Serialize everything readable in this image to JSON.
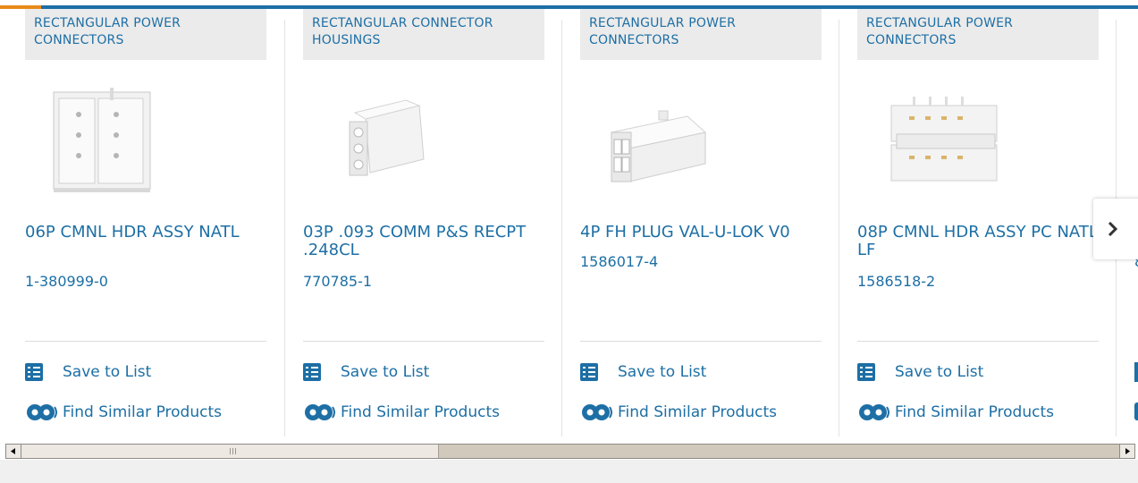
{
  "colors": {
    "brand_blue": "#1d6fa5",
    "accent_orange": "#e88a1a",
    "category_bg": "#ebebeb"
  },
  "cards": [
    {
      "category": "RECTANGULAR POWER CONNECTORS",
      "title": "06P CMNL HDR ASSY NATL",
      "part_number": "1-380999-0",
      "save_label": "Save to List",
      "similar_label": "Find Similar Products"
    },
    {
      "category": "RECTANGULAR CONNECTOR HOUSINGS",
      "title": "03P .093 COMM P&S RECPT .248CL",
      "part_number": "770785-1",
      "save_label": "Save to List",
      "similar_label": "Find Similar Products"
    },
    {
      "category": "RECTANGULAR POWER CONNECTORS",
      "title": "4P FH PLUG VAL-U-LOK V0",
      "part_number": "1586017-4",
      "save_label": "Save to List",
      "similar_label": "Find Similar Products"
    },
    {
      "category": "RECTANGULAR POWER CONNECTORS",
      "title": "08P CMNL HDR ASSY PC NATL LF",
      "part_number": "1586518-2",
      "save_label": "Save to List",
      "similar_label": "Find Similar Products"
    }
  ],
  "partial_card": {
    "part_number_fragment": "8"
  },
  "icons": {
    "next": "chevron-right-icon",
    "save": "checklist-icon",
    "similar": "gears-icon"
  }
}
